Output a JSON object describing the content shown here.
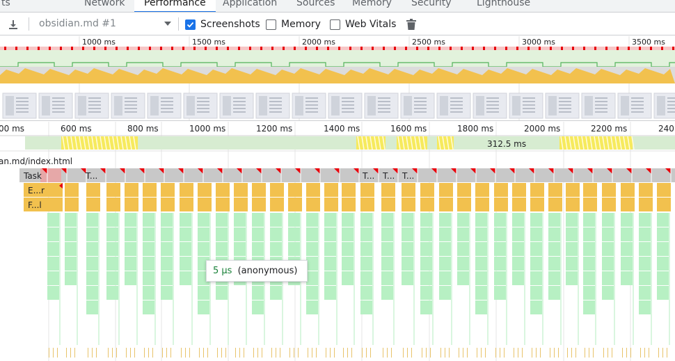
{
  "tabs": [
    {
      "label": "ts",
      "active": false
    },
    {
      "label": "Network",
      "active": false
    },
    {
      "label": "Performance",
      "active": true
    },
    {
      "label": "Application",
      "active": false
    },
    {
      "label": "Sources",
      "active": false
    },
    {
      "label": "Memory",
      "active": false
    },
    {
      "label": "Security",
      "active": false
    },
    {
      "label": "Lighthouse",
      "active": false
    }
  ],
  "toolbar": {
    "download_icon": "download-icon",
    "profile_select": "obsidian.md #1",
    "screenshots_label": "Screenshots",
    "screenshots_checked": true,
    "memory_label": "Memory",
    "memory_checked": false,
    "webvitals_label": "Web Vitals",
    "webvitals_checked": false,
    "trash_icon": "trash-icon"
  },
  "overview": {
    "ruler_labels": [
      "1000 ms",
      "1500 ms",
      "2000 ms",
      "2500 ms",
      "3000 ms",
      "3500 ms"
    ]
  },
  "timeline": {
    "ruler_labels": [
      "00 ms",
      "600 ms",
      "800 ms",
      "1000 ms",
      "1200 ms",
      "1400 ms",
      "1600 ms",
      "1800 ms",
      "2000 ms",
      "2200 ms",
      "240"
    ],
    "frame_duration": "312.5 ms",
    "url": "an.md/index.html",
    "task_label": "Task",
    "task_short": "T...",
    "event_label": "E...r",
    "function_label": "F...l"
  },
  "tooltip": {
    "duration": "5 µs",
    "name": "(anonymous)"
  },
  "colors": {
    "accent": "#1a73e8",
    "scripting": "#f2c14e",
    "task": "#c8c8c8",
    "frames_green": "#d7ecd1",
    "flame_green": "#b7f0c3",
    "longtask_red": "#e8000b"
  }
}
